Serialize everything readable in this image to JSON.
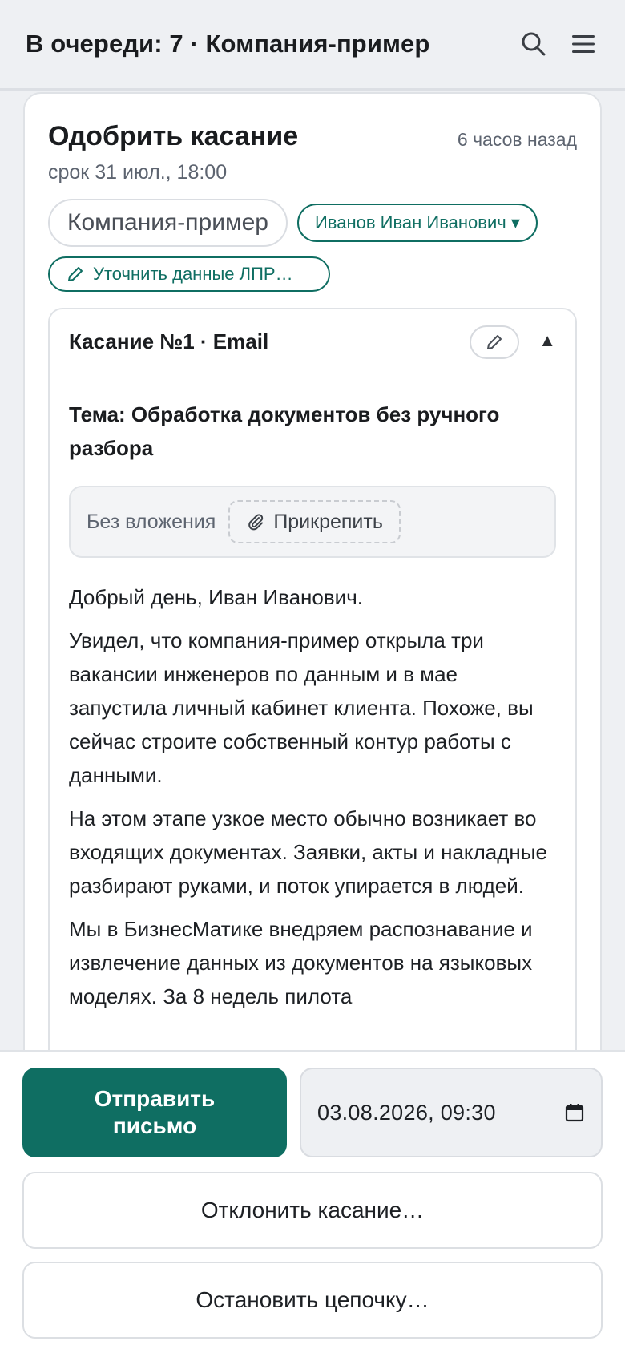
{
  "header": {
    "title": "В очереди: 7 · Компания-пример",
    "icons": [
      "search-icon",
      "menu-icon"
    ]
  },
  "card": {
    "title": "Одобрить касание",
    "time_ago": "6 часов назад",
    "deadline": "срок 31 июл., 18:00",
    "company_chip": "Компания-пример",
    "person_chip": "Иванов Иван Иванович ▾",
    "edit_chip": "Уточнить данные ЛПР…"
  },
  "touch": {
    "title": "Касание №1 · Email",
    "collapse_glyph": "▲",
    "subject": "Тема: Обработка документов без ручного разбора",
    "attachment_label": "Без вложения",
    "attach_button": "Прикрепить",
    "paragraphs": [
      "Добрый день, Иван Иванович.",
      "Увидел, что компания-пример открыла три вакансии инженеров по данным и в мае запустила личный кабинет клиента. Похоже, вы сейчас строите собственный контур работы с данными.",
      "На этом этапе узкое место обычно возникает во входящих документах. Заявки, акты и накладные разбирают руками, и поток упирается в людей.",
      "Мы в БизнесМатике внедряем распознавание и извлечение данных из документов на языковых моделях. За 8 недель пилота"
    ]
  },
  "actions": {
    "send": "Отправить письмо",
    "datetime": "03.08.2026, 09:30",
    "decline": "Отклонить касание…",
    "stop": "Остановить цепочку…"
  },
  "colors": {
    "accent": "#0f6e62",
    "background": "#eef0f3"
  }
}
